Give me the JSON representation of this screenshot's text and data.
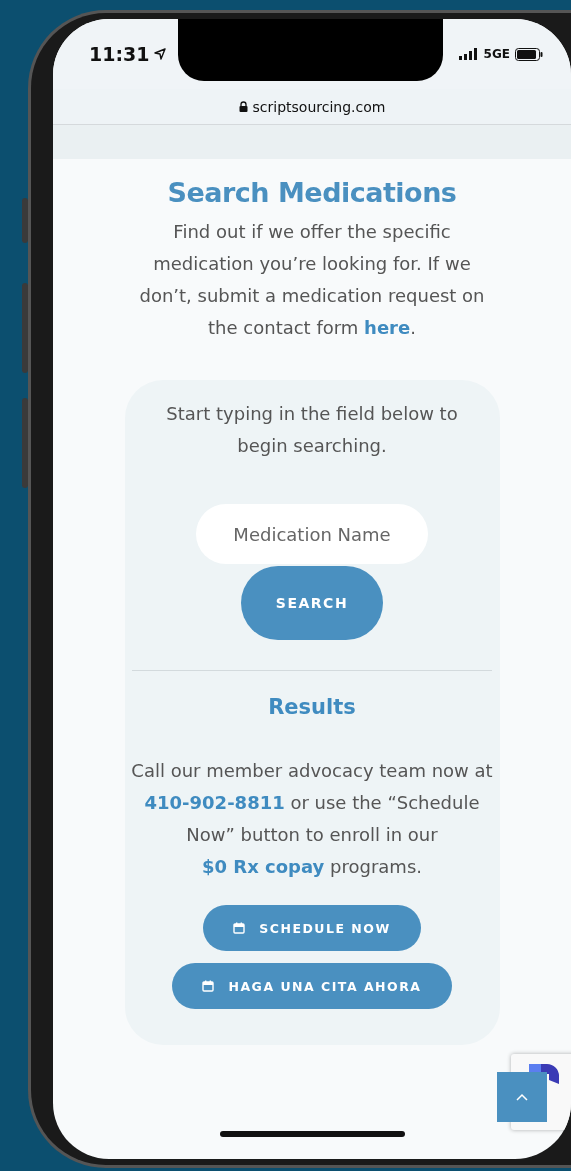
{
  "status_bar": {
    "time": "11:31",
    "network": "5GE"
  },
  "browser": {
    "url": "scriptsourcing.com"
  },
  "title": "Search Medications",
  "intro": [
    {
      "kind": "text",
      "text": "Find out if we offer the specific medication you’re looking for. If we don’t, submit a medication request on the contact form "
    },
    {
      "kind": "link",
      "text": "here"
    },
    {
      "kind": "text",
      "text": "."
    }
  ],
  "search": {
    "instructions": "Start typing in the field below to begin searching.",
    "placeholder": "Medication Name",
    "button": "SEARCH"
  },
  "results": {
    "title": "Results",
    "message": [
      {
        "kind": "text",
        "text": "Call our member advocacy team now at "
      },
      {
        "kind": "link",
        "text": "410-902-8811"
      },
      {
        "kind": "text",
        "text": " or use the “Schedule Now” button to enroll in our "
      },
      {
        "kind": "link",
        "text": "$0 Rx copay"
      },
      {
        "kind": "text",
        "text": " programs."
      }
    ],
    "buttons": [
      {
        "label": "SCHEDULE NOW"
      },
      {
        "label": "HAGA UNA CITA AHORA"
      }
    ]
  }
}
